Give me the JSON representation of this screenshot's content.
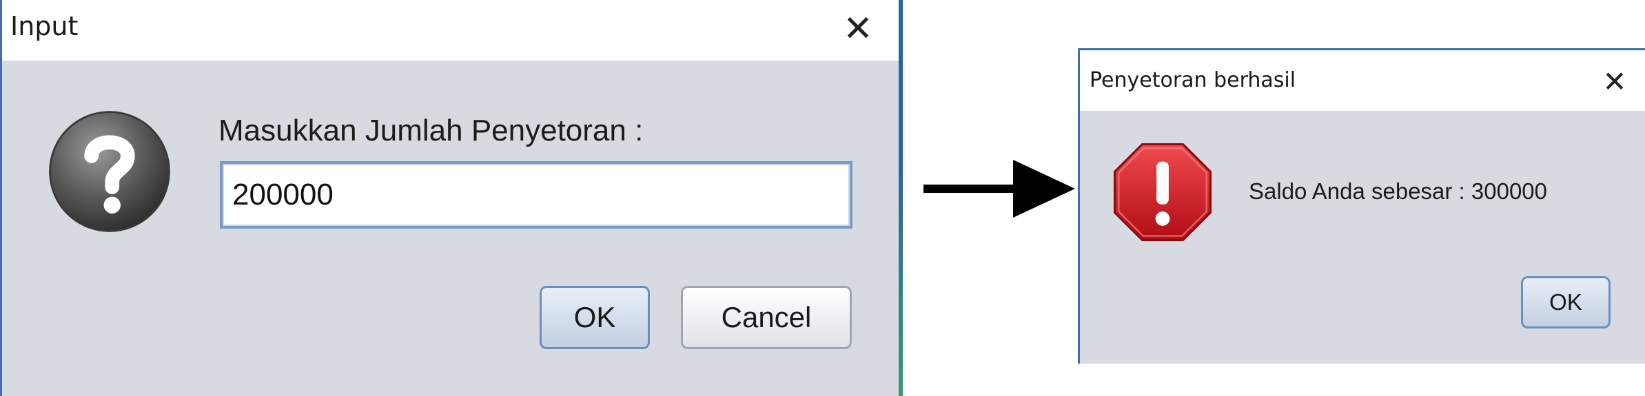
{
  "input_dialog": {
    "title": "Input",
    "close_glyph": "✕",
    "icon": "question-icon",
    "prompt": "Masukkan Jumlah Penyetoran :",
    "field_value": "200000",
    "ok_label": "OK",
    "cancel_label": "Cancel"
  },
  "arrow": {
    "icon": "right-arrow-icon"
  },
  "result_dialog": {
    "title": "Penyetoran berhasil",
    "close_glyph": "✕",
    "icon": "error-stop-icon",
    "message": "Saldo Anda sebesar : 300000",
    "ok_label": "OK"
  },
  "colors": {
    "dialog_bg": "#d8dae1",
    "accent_border": "#3d6fb0",
    "stop_red": "#c8161d"
  }
}
